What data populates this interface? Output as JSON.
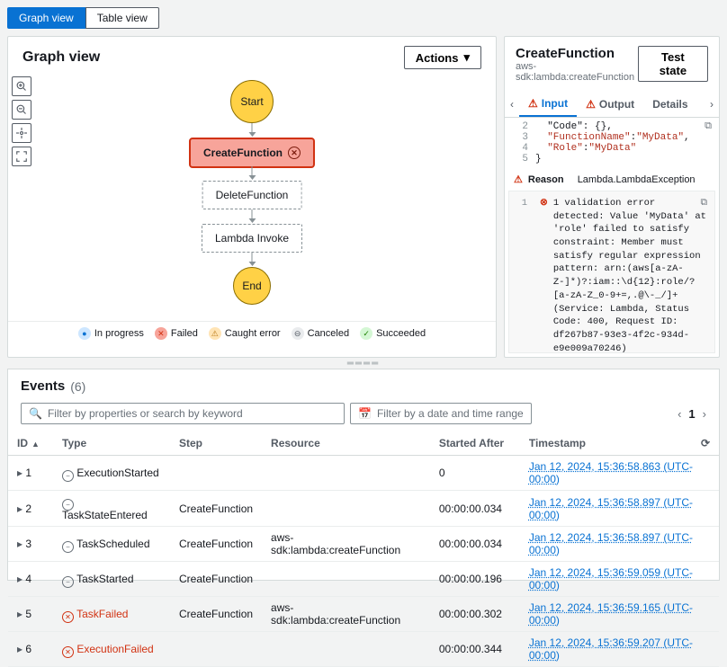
{
  "viewTabs": {
    "graph": "Graph view",
    "table": "Table view"
  },
  "graph": {
    "title": "Graph view",
    "actionsLabel": "Actions",
    "nodes": {
      "start": "Start",
      "createFunction": "CreateFunction",
      "deleteFunction": "DeleteFunction",
      "lambdaInvoke": "Lambda Invoke",
      "end": "End"
    },
    "legend": {
      "inProgress": "In progress",
      "failed": "Failed",
      "caughtError": "Caught error",
      "canceled": "Canceled",
      "succeeded": "Succeeded"
    }
  },
  "details": {
    "title": "CreateFunction",
    "subtitle": "aws-sdk:lambda:createFunction",
    "testBtn": "Test state",
    "tabs": {
      "input": "Input",
      "output": "Output",
      "details": "Details"
    },
    "code": {
      "l2": "\"Code\": {},",
      "l3a": "\"FunctionName\"",
      "l3b": ": ",
      "l3c": "\"MyData\"",
      "l3d": ",",
      "l4a": "\"Role\"",
      "l4b": ": ",
      "l4c": "\"MyData\"",
      "l5": "}"
    },
    "reasonLabel": "Reason",
    "reasonValue": "Lambda.LambdaException",
    "errorLineNo": "1",
    "errorText": "1 validation error detected: Value 'MyData' at 'role' failed to satisfy constraint: Member must satisfy regular expression pattern: arn:(aws[a-zA-Z-]*)?:iam::\\d{12}:role/?[a-zA-Z_0-9+=,.@\\-_/]+ (Service: Lambda, Status Code: 400, Request ID: df267b87-93e3-4f2c-934d-e9e009a70246)"
  },
  "events": {
    "title": "Events",
    "count": "(6)",
    "filterPlaceholder": "Filter by properties or search by keyword",
    "datePlaceholder": "Filter by a date and time range",
    "page": "1",
    "columns": {
      "id": "ID",
      "type": "Type",
      "step": "Step",
      "resource": "Resource",
      "started": "Started After",
      "timestamp": "Timestamp"
    },
    "rows": [
      {
        "id": "1",
        "type": "ExecutionStarted",
        "step": "",
        "resource": "",
        "started": "0",
        "timestamp": "Jan 12, 2024, 15:36:58.863 (UTC-00:00)",
        "fail": false,
        "icon": "minus"
      },
      {
        "id": "2",
        "type": "TaskStateEntered",
        "step": "CreateFunction",
        "resource": "",
        "started": "00:00:00.034",
        "timestamp": "Jan 12, 2024, 15:36:58.897 (UTC-00:00)",
        "fail": false,
        "icon": "minus"
      },
      {
        "id": "3",
        "type": "TaskScheduled",
        "step": "CreateFunction",
        "resource": "aws-sdk:lambda:createFunction",
        "started": "00:00:00.034",
        "timestamp": "Jan 12, 2024, 15:36:58.897 (UTC-00:00)",
        "fail": false,
        "icon": "minus"
      },
      {
        "id": "4",
        "type": "TaskStarted",
        "step": "CreateFunction",
        "resource": "",
        "started": "00:00:00.196",
        "timestamp": "Jan 12, 2024, 15:36:59.059 (UTC-00:00)",
        "fail": false,
        "icon": "minus"
      },
      {
        "id": "5",
        "type": "TaskFailed",
        "step": "CreateFunction",
        "resource": "aws-sdk:lambda:createFunction",
        "started": "00:00:00.302",
        "timestamp": "Jan 12, 2024, 15:36:59.165 (UTC-00:00)",
        "fail": true,
        "icon": "x"
      },
      {
        "id": "6",
        "type": "ExecutionFailed",
        "step": "",
        "resource": "",
        "started": "00:00:00.344",
        "timestamp": "Jan 12, 2024, 15:36:59.207 (UTC-00:00)",
        "fail": true,
        "icon": "x"
      }
    ]
  }
}
